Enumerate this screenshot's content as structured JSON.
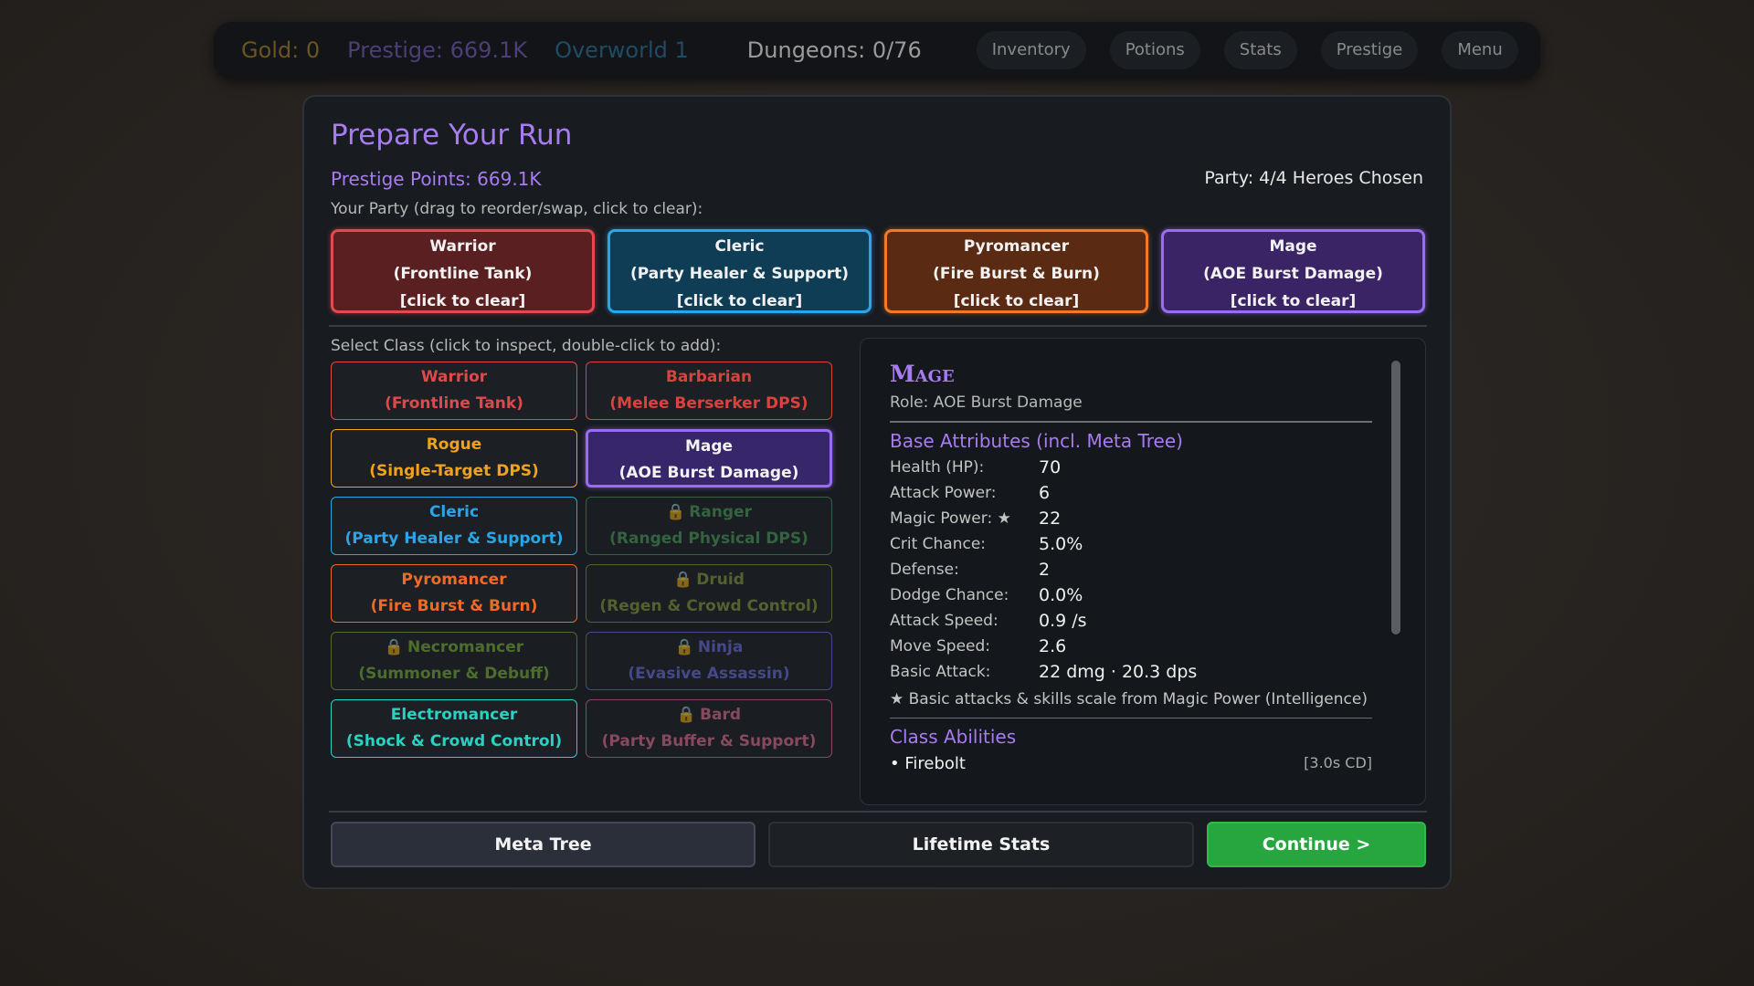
{
  "topbar": {
    "gold": "Gold: 0",
    "prestige": "Prestige: 669.1K",
    "overworld": "Overworld 1",
    "dungeons": "Dungeons: 0/76",
    "nav": [
      "Inventory",
      "Potions",
      "Stats",
      "Prestige",
      "Menu"
    ]
  },
  "panel": {
    "title": "Prepare Your Run",
    "prestige_points": "Prestige Points: 669.1K",
    "party_count": "Party: 4/4 Heroes Chosen",
    "party_hint": "Your Party (drag to reorder/swap, click to clear):",
    "party": [
      {
        "name": "Warrior",
        "role": "(Frontline Tank)",
        "action": "[click to clear]"
      },
      {
        "name": "Cleric",
        "role": "(Party Healer & Support)",
        "action": "[click to clear]"
      },
      {
        "name": "Pyromancer",
        "role": "(Fire Burst & Burn)",
        "action": "[click to clear]"
      },
      {
        "name": "Mage",
        "role": "(AOE Burst Damage)",
        "action": "[click to clear]"
      }
    ],
    "select_hint": "Select Class (click to inspect, double-click to add):",
    "classes": [
      {
        "name": "Warrior",
        "role": "(Frontline Tank)",
        "color": "#e0494c",
        "locked": false
      },
      {
        "name": "Barbarian",
        "role": "(Melee Berserker DPS)",
        "color": "#d9433c",
        "locked": false
      },
      {
        "name": "Rogue",
        "role": "(Single-Target DPS)",
        "color": "#f0a21c",
        "locked": false
      },
      {
        "name": "Mage",
        "role": "(AOE Burst Damage)",
        "color": "#9a6cf2",
        "locked": false
      },
      {
        "name": "Cleric",
        "role": "(Party Healer & Support)",
        "color": "#2aa6e8",
        "locked": false
      },
      {
        "name": "Ranger",
        "role": "(Ranged Physical DPS)",
        "color": "#4a9e5a",
        "locked": true
      },
      {
        "name": "Pyromancer",
        "role": "(Fire Burst & Burn)",
        "color": "#f0692a",
        "locked": false
      },
      {
        "name": "Druid",
        "role": "(Regen & Crowd Control)",
        "color": "#8a9a3a",
        "locked": true
      },
      {
        "name": "Necromancer",
        "role": "(Summoner & Debuff)",
        "color": "#7ab03a",
        "locked": true
      },
      {
        "name": "Ninja",
        "role": "(Evasive Assassin)",
        "color": "#6a6ee0",
        "locked": true
      },
      {
        "name": "Electromancer",
        "role": "(Shock & Crowd Control)",
        "color": "#2ad0c0",
        "locked": false
      },
      {
        "name": "Bard",
        "role": "(Party Buffer & Support)",
        "color": "#e07090",
        "locked": true
      }
    ],
    "lock_icon": "🔒",
    "inspect": {
      "name": "Mage",
      "role": "Role: AOE Burst Damage",
      "attr_title": "Base Attributes (incl. Meta Tree)",
      "attributes": [
        {
          "k": "Health (HP):",
          "v": "70"
        },
        {
          "k": "Attack Power:",
          "v": "6"
        },
        {
          "k": "Magic Power: ★",
          "v": "22"
        },
        {
          "k": "Crit Chance:",
          "v": "5.0%"
        },
        {
          "k": "Defense:",
          "v": "2"
        },
        {
          "k": "Dodge Chance:",
          "v": "0.0%"
        },
        {
          "k": "Attack Speed:",
          "v": "0.9 /s"
        },
        {
          "k": "Move Speed:",
          "v": "2.6"
        },
        {
          "k": "Basic Attack:",
          "v": "22 dmg · 20.3 dps"
        }
      ],
      "note": "★ Basic attacks & skills scale from Magic Power (Intelligence)",
      "abilities_title": "Class Abilities",
      "abilities": [
        {
          "name": "• Firebolt",
          "cd": "[3.0s CD]"
        }
      ]
    },
    "buttons": {
      "meta": "Meta Tree",
      "lifetime": "Lifetime Stats",
      "continue": "Continue >"
    }
  }
}
